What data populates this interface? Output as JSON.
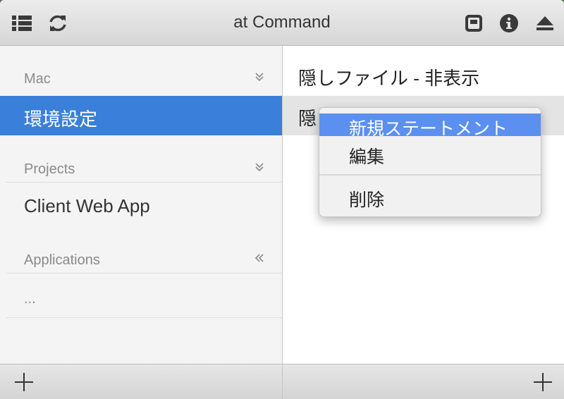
{
  "window": {
    "title": "at Command"
  },
  "toolbar": {
    "left_icons": [
      "list-icon",
      "refresh-icon"
    ],
    "right_icons": [
      "window-icon",
      "info-icon",
      "eject-icon"
    ]
  },
  "sidebar": {
    "sections": [
      {
        "label": "Mac",
        "toggle": "double-chevron-down",
        "items": [
          "環境設定"
        ]
      },
      {
        "label": "Projects",
        "toggle": "double-chevron-down",
        "items": [
          "Client Web App"
        ]
      },
      {
        "label": "Applications",
        "toggle": "double-chevron-left",
        "items": [
          "..."
        ]
      }
    ]
  },
  "main": {
    "statements": [
      {
        "label": "隠しファイル - 非表示"
      },
      {
        "label": "隠"
      }
    ]
  },
  "context_menu": {
    "items": [
      {
        "label": "新規ステートメント"
      },
      {
        "label": "編集"
      },
      {
        "label": "削除"
      }
    ]
  },
  "colors": {
    "selection": "#3a7fd9",
    "menu_highlight": "#5b8ff0",
    "icon": "#3a3a3a"
  }
}
